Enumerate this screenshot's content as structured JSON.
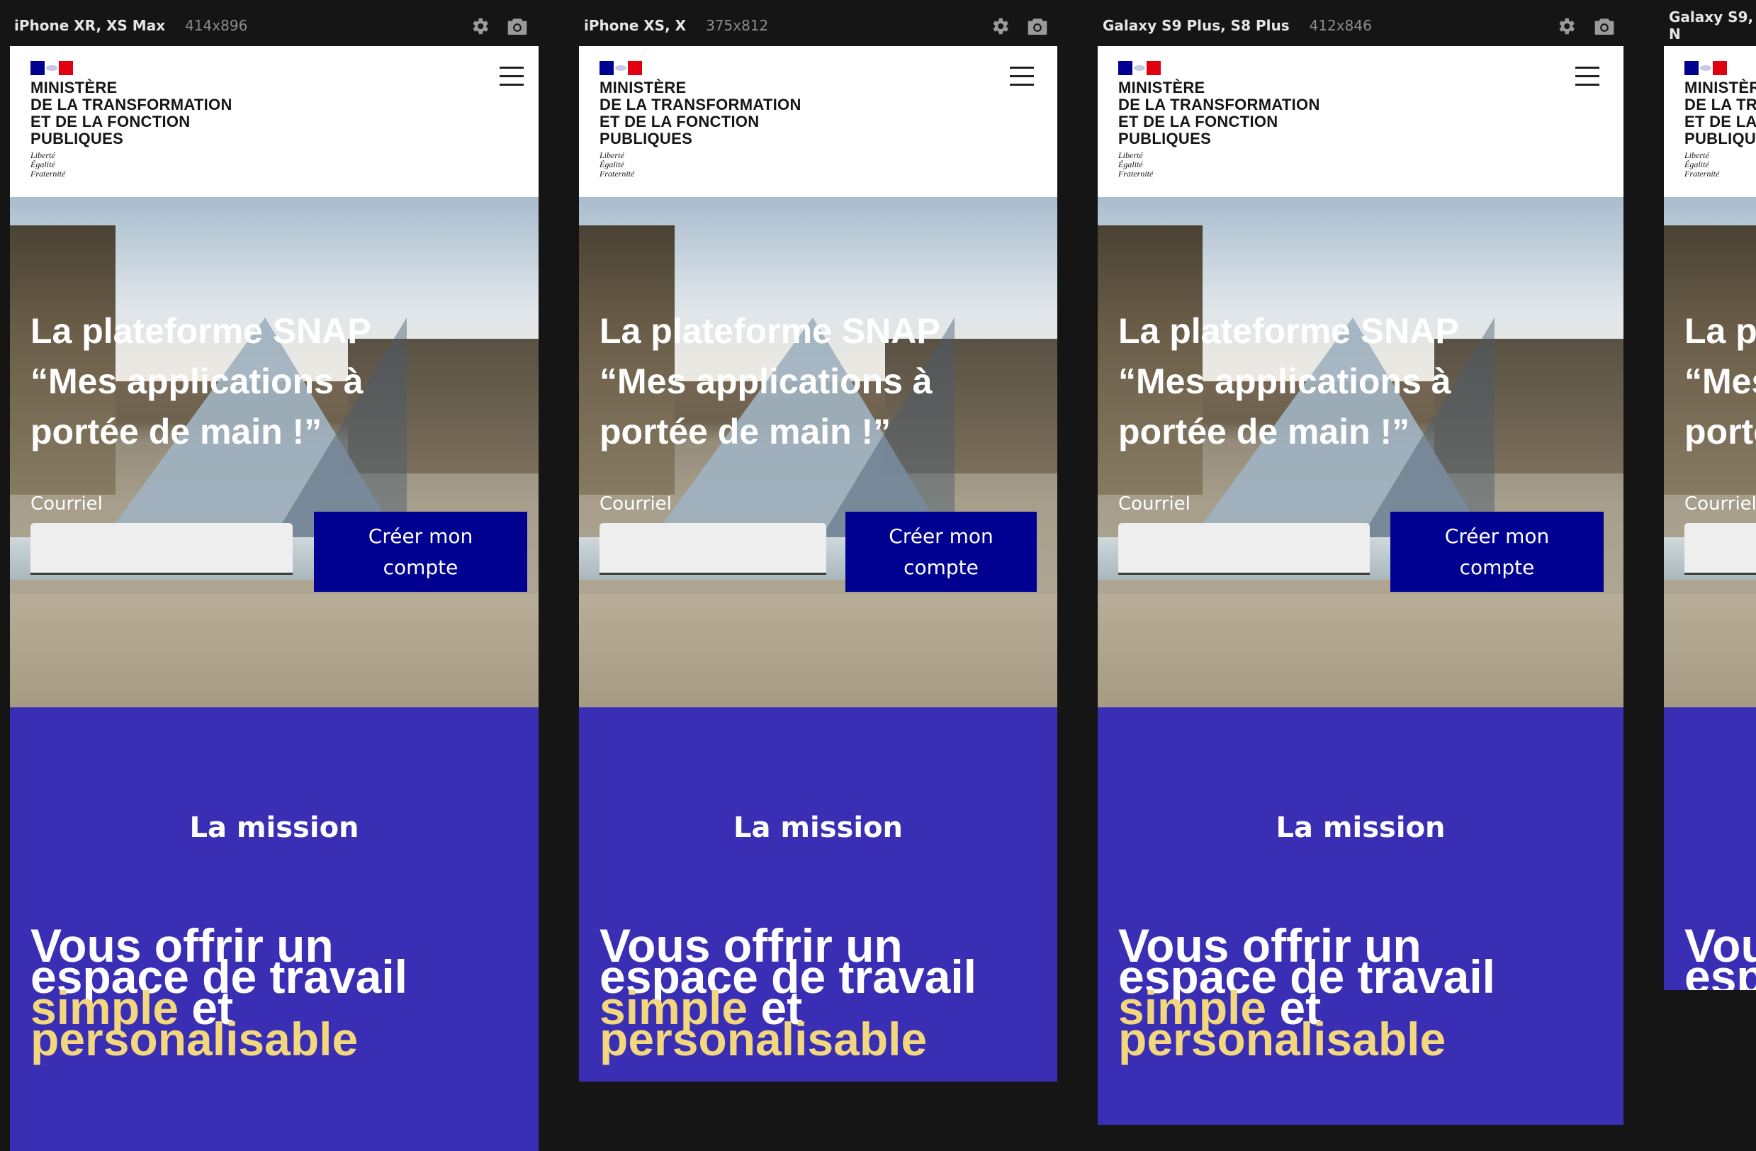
{
  "devices": [
    {
      "name": "iPhone XR, XS Max",
      "size": "414x896"
    },
    {
      "name": "iPhone XS, X",
      "size": "375x812"
    },
    {
      "name": "Galaxy S9 Plus, S8 Plus",
      "size": "412x846"
    },
    {
      "name": "Galaxy S9, N",
      "size": ""
    }
  ],
  "toolbar": {
    "settings_icon": "gear-icon",
    "screenshot_icon": "camera-icon"
  },
  "site": {
    "ministry_lines": [
      "MINISTÈRE",
      "DE LA TRANSFORMATION",
      "ET DE LA FONCTION",
      "PUBLIQUES"
    ],
    "motto_lines": [
      "Liberté",
      "Égalité",
      "Fraternité"
    ],
    "menu_icon": "hamburger-menu-icon"
  },
  "hero": {
    "title_lines": [
      "La plateforme SNAP",
      "“Mes applications à",
      "portée de main !”"
    ],
    "email_label": "Courriel",
    "cta_line1": "Créer mon",
    "cta_line2": "compte"
  },
  "mission": {
    "heading": "La mission",
    "line1": "Vous offrir un",
    "line2": "espace de travail",
    "highlight1": "simple",
    "and": " et",
    "highlight2": "personalisable"
  },
  "colors": {
    "background": "#151515",
    "brand_blue": "#000091",
    "section_purple": "#3a2fb4",
    "highlight_yellow": "#f2d77c",
    "flag_red": "#e1000f"
  }
}
